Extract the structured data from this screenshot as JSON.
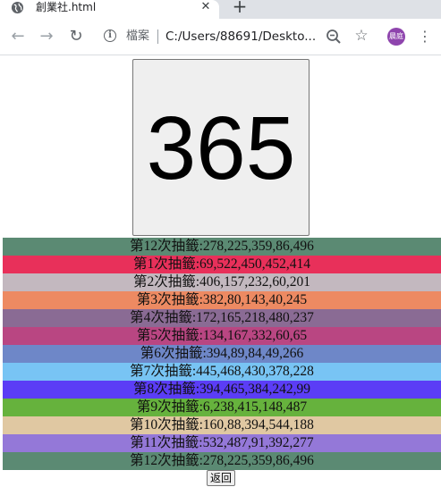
{
  "tab": {
    "title": "創業社.html",
    "close": "✕",
    "new_tab": "+"
  },
  "toolbar": {
    "back": "←",
    "forward": "→",
    "reload": "↻",
    "scheme_label": "檔案",
    "url": "C:/Users/88691/Deskto...",
    "star": "☆",
    "avatar_text": "晨庭",
    "avatar_color": "#8e44ad",
    "menu": "⋮"
  },
  "main": {
    "number": "365",
    "back_button": "返回",
    "draws": [
      {
        "text": "第12次抽籤:278,225,359,86,496",
        "color": "#5b8a73"
      },
      {
        "text": "第1次抽籤:69,522,450,452,414",
        "color": "#e8305a"
      },
      {
        "text": "第2次抽籤:406,157,232,60,201",
        "color": "#c3b8bf"
      },
      {
        "text": "第3次抽籤:382,80,143,40,245",
        "color": "#ed8a62"
      },
      {
        "text": "第4次抽籤:172,165,218,480,237",
        "color": "#8a6b94"
      },
      {
        "text": "第5次抽籤:134,167,332,60,65",
        "color": "#b94682"
      },
      {
        "text": "第6次抽籤:394,89,84,49,266",
        "color": "#6e87c8"
      },
      {
        "text": "第7次抽籤:445,468,430,378,228",
        "color": "#78c4f4"
      },
      {
        "text": "第8次抽籤:394,465,384,242,99",
        "color": "#5b3df6"
      },
      {
        "text": "第9次抽籤:6,238,415,148,487",
        "color": "#66b23d"
      },
      {
        "text": "第10次抽籤:160,88,394,544,188",
        "color": "#e0c8a2"
      },
      {
        "text": "第11次抽籤:532,487,91,392,277",
        "color": "#9478d8"
      },
      {
        "text": "第12次抽籤:278,225,359,86,496",
        "color": "#5b8a73"
      }
    ]
  }
}
